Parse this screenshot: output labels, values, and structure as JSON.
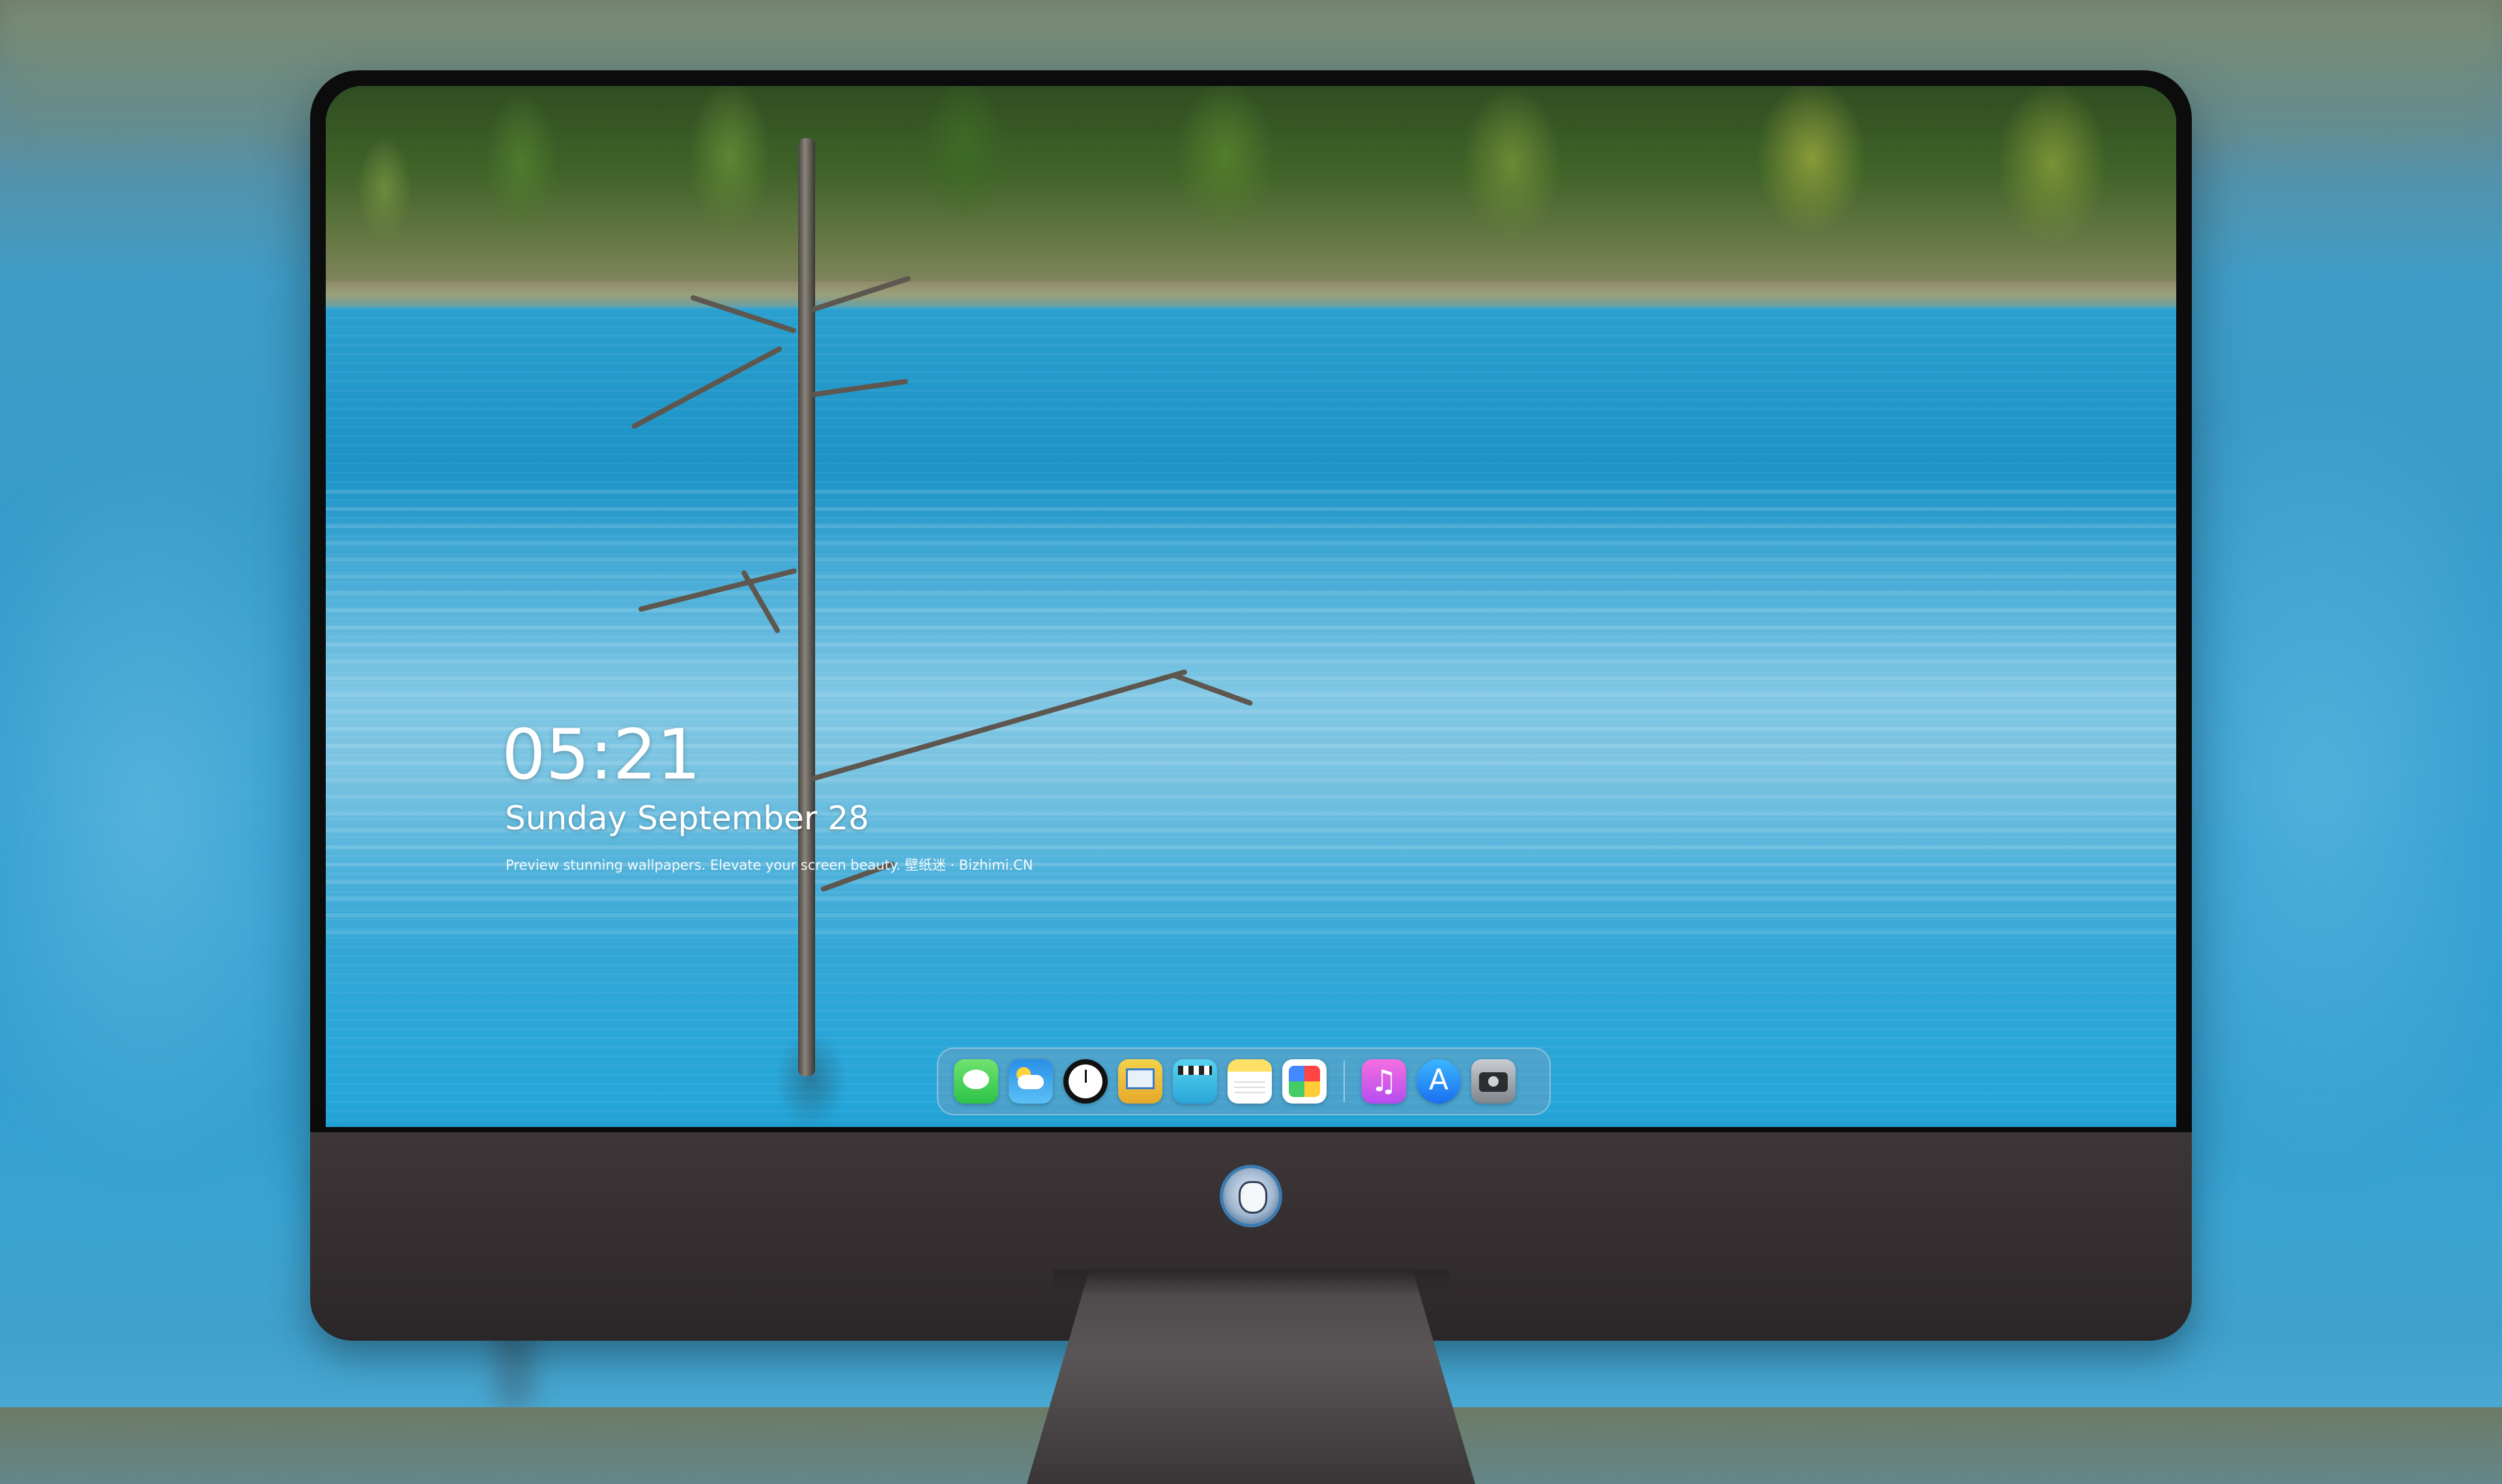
{
  "lock_screen": {
    "time": "05:21",
    "date": "Sunday September  28",
    "tagline": "Preview stunning wallpapers. Elevate your screen beauty. 壁纸迷 · Bizhimi.CN"
  },
  "dock": {
    "items": [
      {
        "icon": "messages-icon"
      },
      {
        "icon": "weather-icon"
      },
      {
        "icon": "clock-icon"
      },
      {
        "icon": "preview-icon"
      },
      {
        "icon": "clips-icon"
      },
      {
        "icon": "notes-icon"
      },
      {
        "icon": "photos-icon"
      },
      {
        "icon": "music-icon"
      },
      {
        "icon": "app-store-icon"
      },
      {
        "icon": "camera-icon"
      }
    ]
  },
  "colors": {
    "wallpaper_lake": "#2aa6d6",
    "monitor_bezel": "#0c0c0d",
    "monitor_chin": "#332d2f"
  }
}
